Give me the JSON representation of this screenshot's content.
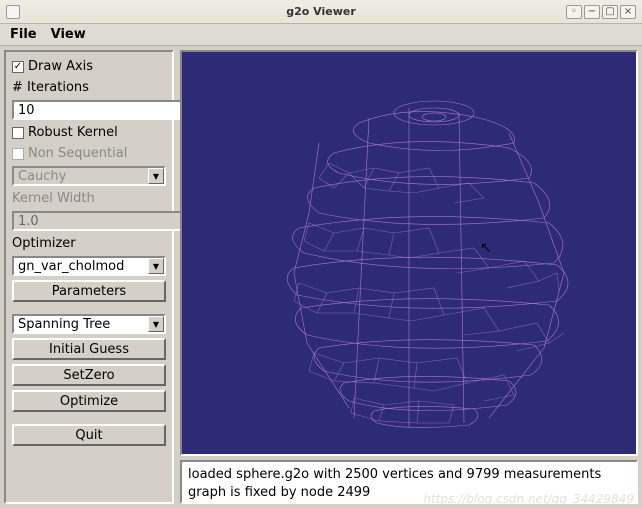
{
  "window": {
    "title": "g2o Viewer"
  },
  "menu": {
    "file": "File",
    "view": "View"
  },
  "sidebar": {
    "draw_axis": {
      "label": "Draw Axis",
      "checked": true
    },
    "iterations_label": "# Iterations",
    "iterations_value": "10",
    "robust_kernel": {
      "label": "Robust Kernel",
      "checked": false
    },
    "non_sequential": {
      "label": "Non Sequential",
      "checked": false,
      "enabled": false
    },
    "kernel_combo": {
      "value": "Cauchy",
      "enabled": false
    },
    "kernel_width_label": "Kernel Width",
    "kernel_width_value": "1.0",
    "optimizer_label": "Optimizer",
    "optimizer_combo": {
      "value": "gn_var_cholmod"
    },
    "parameters_btn": "Parameters",
    "tree_combo": {
      "value": "Spanning Tree"
    },
    "initial_guess_btn": "Initial Guess",
    "setzero_btn": "SetZero",
    "optimize_btn": "Optimize",
    "quit_btn": "Quit"
  },
  "status": {
    "line1": "loaded sphere.g2o with 2500 vertices and 9799 measurements",
    "line2": "graph is fixed by node 2499"
  },
  "colors": {
    "viewport_bg": "#2e2b76",
    "wireframe": "#b97fd8"
  },
  "watermark": "https://blog.csdn.net/qq_34429849"
}
